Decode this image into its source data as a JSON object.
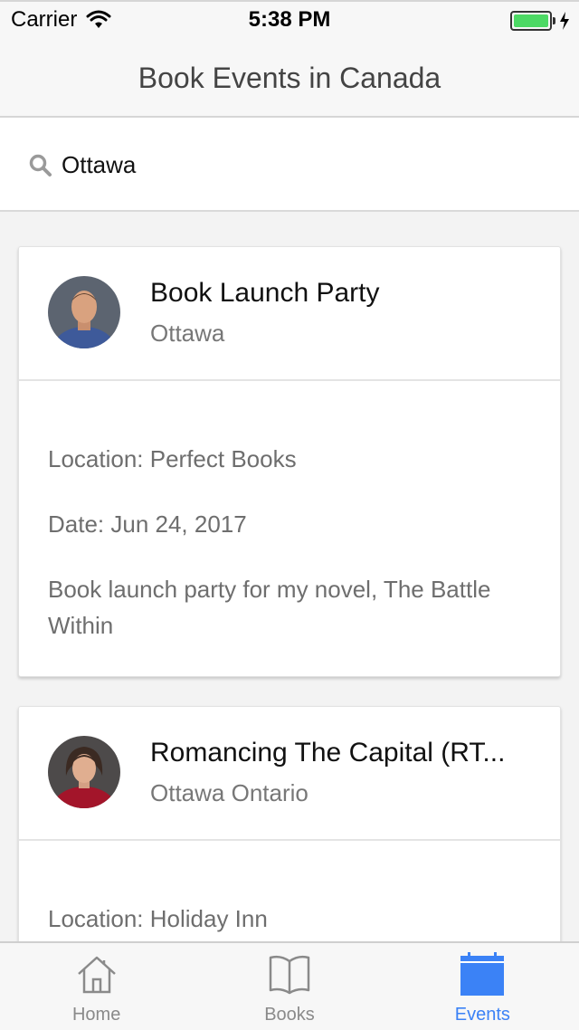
{
  "status_bar": {
    "carrier": "Carrier",
    "time": "5:38 PM"
  },
  "nav": {
    "title": "Book Events in Canada"
  },
  "search": {
    "value": "Ottawa",
    "icon": "search-icon"
  },
  "events": [
    {
      "title": "Book Launch Party",
      "city": "Ottawa",
      "location": "Location: Perfect Books",
      "date": "Date: Jun 24, 2017",
      "description": "Book launch party for my novel, The Battle Within"
    },
    {
      "title": "Romancing The Capital (RT...",
      "city": "Ottawa Ontario",
      "location": "Location: Holiday Inn"
    }
  ],
  "tabs": [
    {
      "label": "Home",
      "icon": "home-icon",
      "active": false
    },
    {
      "label": "Books",
      "icon": "book-icon",
      "active": false
    },
    {
      "label": "Events",
      "icon": "calendar-icon",
      "active": true
    }
  ],
  "colors": {
    "accent": "#3b82f6",
    "battery": "#4cd964"
  }
}
